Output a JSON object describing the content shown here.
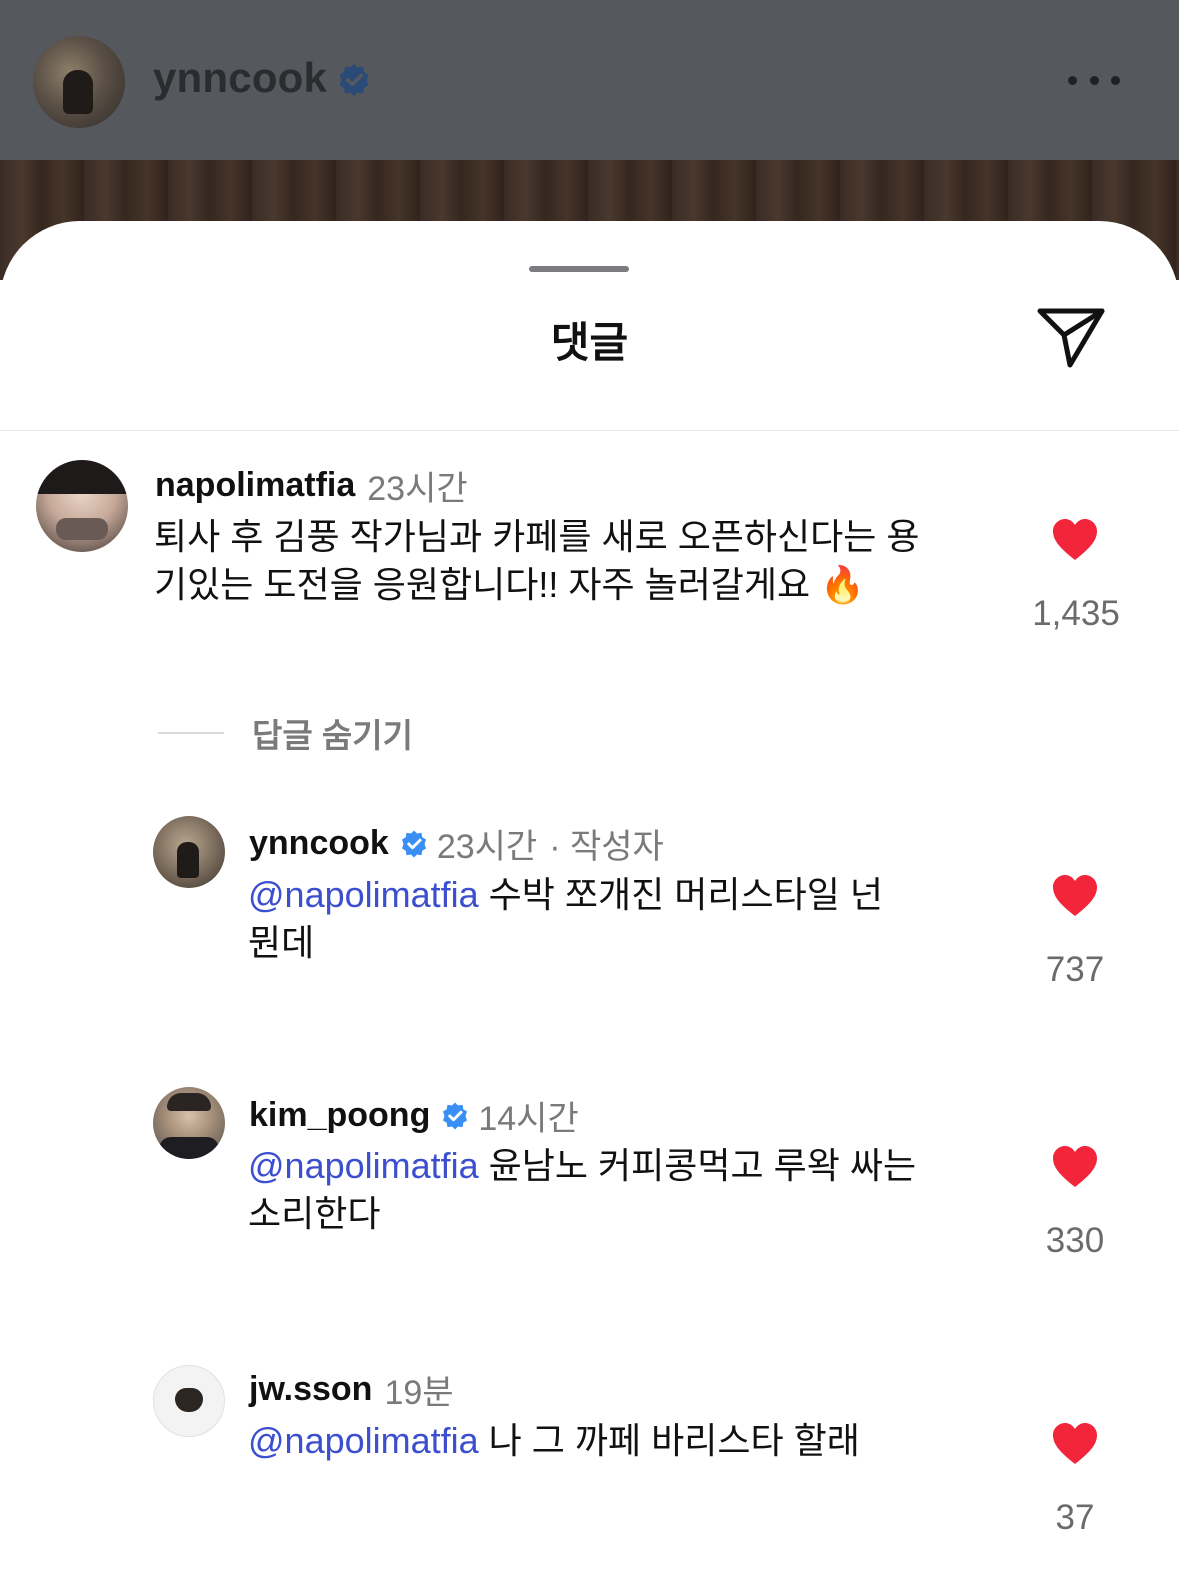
{
  "post": {
    "username": "ynncook",
    "avatar_icon": "avatar-photo-icon",
    "more_icon": "more-dots-icon"
  },
  "sheet": {
    "title": "댓글",
    "share_icon": "paper-plane-icon"
  },
  "comments": [
    {
      "username": "napolimatfia",
      "verified": false,
      "time": "23시간",
      "text_line1": "퇴사 후 김풍 작가님과 카페를 새로 오픈하신다는 용",
      "text_line2": "기있는 도전을 응원합니다!! 자주 놀러갈게요",
      "emoji": "🔥",
      "likes": "1,435"
    }
  ],
  "hide_replies_label": "답글 숨기기",
  "replies": [
    {
      "username": "ynncook",
      "verified": true,
      "time": "23시간",
      "role": "· 작성자",
      "mention": "@napolimatfia",
      "text_line1": " 수박 쪼개진 머리스타일 넌",
      "text_line2": "뭔데",
      "likes": "737"
    },
    {
      "username": "kim_poong",
      "verified": true,
      "time": "14시간",
      "mention": "@napolimatfia",
      "text_line1": " 윤남노 커피콩먹고 루왁 싸는",
      "text_line2": "소리한다",
      "likes": "330"
    },
    {
      "username": "jw.sson",
      "verified": false,
      "time": "19분",
      "mention": "@napolimatfia",
      "text_line1": " 나 그 까페 바리스타 할래",
      "likes": "37"
    }
  ],
  "colors": {
    "heart": "#f2253b",
    "mention": "#3b4fcf",
    "verified": "#3a8ff5"
  }
}
